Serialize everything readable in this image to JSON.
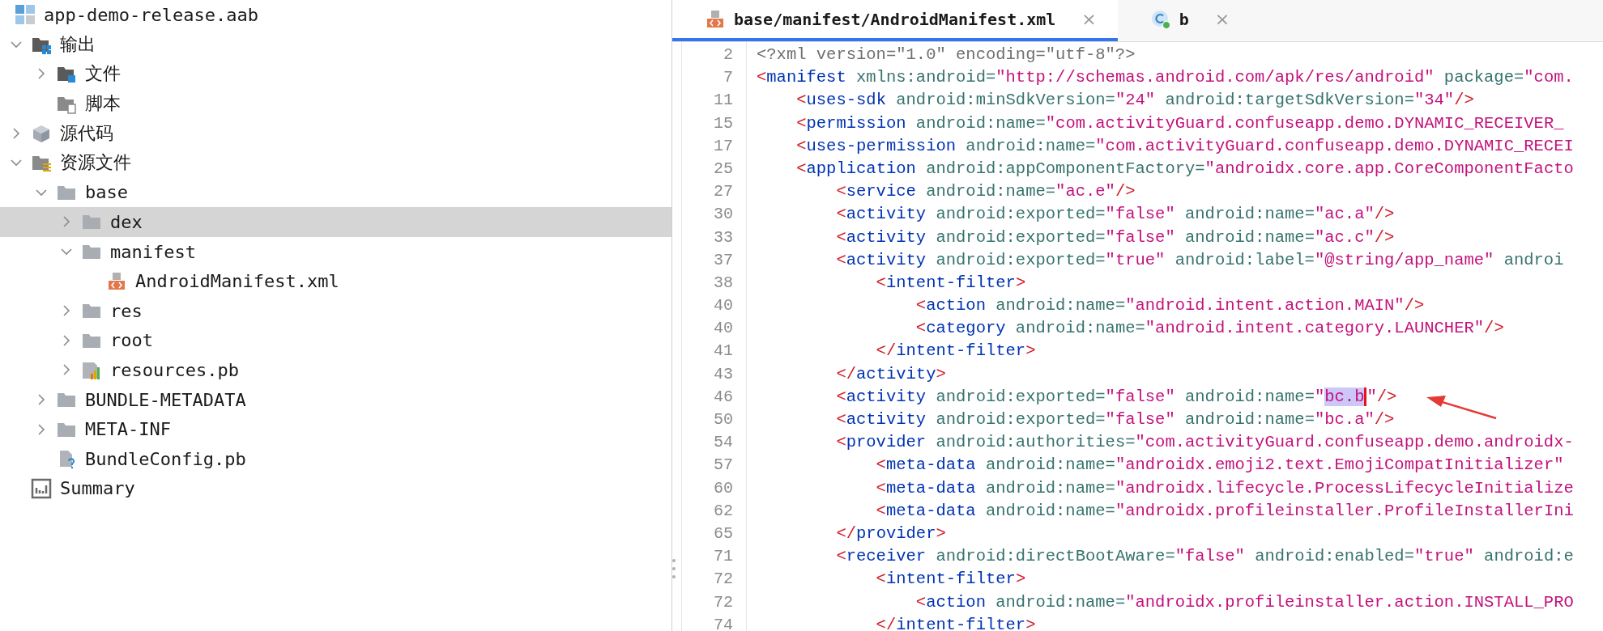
{
  "bundle": {
    "label": "app-demo-release.aab"
  },
  "tree": [
    {
      "label": "输出",
      "kind": "output-folder",
      "expanded": true,
      "selected": false,
      "children": [
        {
          "label": "文件",
          "kind": "files-folder",
          "expanded": false,
          "selected": false
        },
        {
          "label": "脚本",
          "kind": "scripts-folder",
          "selected": false
        }
      ]
    },
    {
      "label": "源代码",
      "kind": "source-package",
      "expanded": false,
      "selected": false
    },
    {
      "label": "资源文件",
      "kind": "resource-folder",
      "expanded": true,
      "selected": false,
      "children": [
        {
          "label": "base",
          "kind": "folder",
          "expanded": true,
          "selected": false,
          "children": [
            {
              "label": "dex",
              "kind": "folder",
              "expanded": false,
              "selected": true
            },
            {
              "label": "manifest",
              "kind": "folder",
              "expanded": true,
              "selected": false,
              "children": [
                {
                  "label": "AndroidManifest.xml",
                  "kind": "xml-file",
                  "selected": false
                }
              ]
            },
            {
              "label": "res",
              "kind": "folder",
              "expanded": false,
              "selected": false
            },
            {
              "label": "root",
              "kind": "folder",
              "expanded": false,
              "selected": false
            },
            {
              "label": "resources.pb",
              "kind": "resource-table",
              "expanded": false,
              "selected": false
            }
          ]
        },
        {
          "label": "BUNDLE-METADATA",
          "kind": "folder",
          "expanded": false,
          "selected": false
        },
        {
          "label": "META-INF",
          "kind": "folder",
          "expanded": false,
          "selected": false
        },
        {
          "label": "BundleConfig.pb",
          "kind": "config-file",
          "selected": false
        }
      ]
    },
    {
      "label": "Summary",
      "kind": "summary",
      "selected": false
    }
  ],
  "tabs": [
    {
      "label": "base/manifest/AndroidManifest.xml",
      "kind": "xml-file",
      "selected": true,
      "close": "×"
    },
    {
      "label": "b",
      "kind": "class-file",
      "selected": false,
      "close": "×"
    }
  ],
  "code_lines": [
    {
      "number": "2",
      "tokens": [
        {
          "kind": "pi",
          "text": "<?xml version=\"1.0\" encoding=\"utf-8\"?>"
        }
      ]
    },
    {
      "number": "7",
      "tokens": [
        {
          "kind": "bracket",
          "text": "<"
        },
        {
          "kind": "tag",
          "text": "manifest"
        },
        {
          "kind": "attr",
          "text": " xmlns:android="
        },
        {
          "kind": "value",
          "text": "\"http://schemas.android.com/apk/res/android\""
        },
        {
          "kind": "attr",
          "text": " package="
        },
        {
          "kind": "value",
          "text": "\"com."
        }
      ]
    },
    {
      "number": "11",
      "tokens": [
        {
          "kind": "bracket",
          "text": "    <"
        },
        {
          "kind": "tag",
          "text": "uses-sdk"
        },
        {
          "kind": "attr",
          "text": " android:minSdkVersion="
        },
        {
          "kind": "value",
          "text": "\"24\""
        },
        {
          "kind": "attr",
          "text": " android:targetSdkVersion="
        },
        {
          "kind": "value",
          "text": "\"34\""
        },
        {
          "kind": "bracket",
          "text": "/>"
        }
      ]
    },
    {
      "number": "15",
      "tokens": [
        {
          "kind": "bracket",
          "text": "    <"
        },
        {
          "kind": "tag",
          "text": "permission"
        },
        {
          "kind": "attr",
          "text": " android:name="
        },
        {
          "kind": "value",
          "text": "\"com.activityGuard.confuseapp.demo.DYNAMIC_RECEIVER_"
        }
      ]
    },
    {
      "number": "17",
      "tokens": [
        {
          "kind": "bracket",
          "text": "    <"
        },
        {
          "kind": "tag",
          "text": "uses-permission"
        },
        {
          "kind": "attr",
          "text": " android:name="
        },
        {
          "kind": "value",
          "text": "\"com.activityGuard.confuseapp.demo.DYNAMIC_RECEI"
        }
      ]
    },
    {
      "number": "25",
      "tokens": [
        {
          "kind": "bracket",
          "text": "    <"
        },
        {
          "kind": "tag",
          "text": "application"
        },
        {
          "kind": "attr",
          "text": " android:appComponentFactory="
        },
        {
          "kind": "value",
          "text": "\"androidx.core.app.CoreComponentFacto"
        }
      ]
    },
    {
      "number": "27",
      "tokens": [
        {
          "kind": "bracket",
          "text": "        <"
        },
        {
          "kind": "tag",
          "text": "service"
        },
        {
          "kind": "attr",
          "text": " android:name="
        },
        {
          "kind": "value",
          "text": "\"ac.e\""
        },
        {
          "kind": "bracket",
          "text": "/>"
        }
      ]
    },
    {
      "number": "30",
      "tokens": [
        {
          "kind": "bracket",
          "text": "        <"
        },
        {
          "kind": "tag",
          "text": "activity"
        },
        {
          "kind": "attr",
          "text": " android:exported="
        },
        {
          "kind": "value",
          "text": "\"false\""
        },
        {
          "kind": "attr",
          "text": " android:name="
        },
        {
          "kind": "value",
          "text": "\"ac.a\""
        },
        {
          "kind": "bracket",
          "text": "/>"
        }
      ]
    },
    {
      "number": "33",
      "tokens": [
        {
          "kind": "bracket",
          "text": "        <"
        },
        {
          "kind": "tag",
          "text": "activity"
        },
        {
          "kind": "attr",
          "text": " android:exported="
        },
        {
          "kind": "value",
          "text": "\"false\""
        },
        {
          "kind": "attr",
          "text": " android:name="
        },
        {
          "kind": "value",
          "text": "\"ac.c\""
        },
        {
          "kind": "bracket",
          "text": "/>"
        }
      ]
    },
    {
      "number": "37",
      "tokens": [
        {
          "kind": "bracket",
          "text": "        <"
        },
        {
          "kind": "tag",
          "text": "activity"
        },
        {
          "kind": "attr",
          "text": " android:exported="
        },
        {
          "kind": "value",
          "text": "\"true\""
        },
        {
          "kind": "attr",
          "text": " android:label="
        },
        {
          "kind": "value",
          "text": "\"@string/app_name\""
        },
        {
          "kind": "attr",
          "text": " androi"
        }
      ]
    },
    {
      "number": "38",
      "tokens": [
        {
          "kind": "bracket",
          "text": "            <"
        },
        {
          "kind": "tag",
          "text": "intent-filter"
        },
        {
          "kind": "bracket",
          "text": ">"
        }
      ]
    },
    {
      "number": "40",
      "tokens": [
        {
          "kind": "bracket",
          "text": "                <"
        },
        {
          "kind": "tag",
          "text": "action"
        },
        {
          "kind": "attr",
          "text": " android:name="
        },
        {
          "kind": "value",
          "text": "\"android.intent.action.MAIN\""
        },
        {
          "kind": "bracket",
          "text": "/>"
        }
      ]
    },
    {
      "number": "40",
      "tokens": [
        {
          "kind": "bracket",
          "text": "                <"
        },
        {
          "kind": "tag",
          "text": "category"
        },
        {
          "kind": "attr",
          "text": " android:name="
        },
        {
          "kind": "value",
          "text": "\"android.intent.category.LAUNCHER\""
        },
        {
          "kind": "bracket",
          "text": "/>"
        }
      ]
    },
    {
      "number": "41",
      "tokens": [
        {
          "kind": "bracket",
          "text": "            </"
        },
        {
          "kind": "tag",
          "text": "intent-filter"
        },
        {
          "kind": "bracket",
          "text": ">"
        }
      ]
    },
    {
      "number": "43",
      "tokens": [
        {
          "kind": "bracket",
          "text": "        </"
        },
        {
          "kind": "tag",
          "text": "activity"
        },
        {
          "kind": "bracket",
          "text": ">"
        }
      ]
    },
    {
      "number": "46",
      "tokens": [
        {
          "kind": "bracket",
          "text": "        <"
        },
        {
          "kind": "tag",
          "text": "activity"
        },
        {
          "kind": "attr",
          "text": " android:exported="
        },
        {
          "kind": "value",
          "text": "\"false\""
        },
        {
          "kind": "attr",
          "text": " android:name="
        },
        {
          "kind": "value",
          "text": "\""
        },
        {
          "kind": "selection",
          "text": "bc.b"
        },
        {
          "kind": "value",
          "text": "\""
        },
        {
          "kind": "bracket",
          "text": "/>"
        }
      ]
    },
    {
      "number": "50",
      "tokens": [
        {
          "kind": "bracket",
          "text": "        <"
        },
        {
          "kind": "tag",
          "text": "activity"
        },
        {
          "kind": "attr",
          "text": " android:exported="
        },
        {
          "kind": "value",
          "text": "\"false\""
        },
        {
          "kind": "attr",
          "text": " android:name="
        },
        {
          "kind": "value",
          "text": "\"bc.a\""
        },
        {
          "kind": "bracket",
          "text": "/>"
        }
      ]
    },
    {
      "number": "54",
      "tokens": [
        {
          "kind": "bracket",
          "text": "        <"
        },
        {
          "kind": "tag",
          "text": "provider"
        },
        {
          "kind": "attr",
          "text": " android:authorities="
        },
        {
          "kind": "value",
          "text": "\"com.activityGuard.confuseapp.demo.androidx-"
        }
      ]
    },
    {
      "number": "57",
      "tokens": [
        {
          "kind": "bracket",
          "text": "            <"
        },
        {
          "kind": "tag",
          "text": "meta-data"
        },
        {
          "kind": "attr",
          "text": " android:name="
        },
        {
          "kind": "value",
          "text": "\"androidx.emoji2.text.EmojiCompatInitializer\""
        }
      ]
    },
    {
      "number": "60",
      "tokens": [
        {
          "kind": "bracket",
          "text": "            <"
        },
        {
          "kind": "tag",
          "text": "meta-data"
        },
        {
          "kind": "attr",
          "text": " android:name="
        },
        {
          "kind": "value",
          "text": "\"androidx.lifecycle.ProcessLifecycleInitialize"
        }
      ]
    },
    {
      "number": "62",
      "tokens": [
        {
          "kind": "bracket",
          "text": "            <"
        },
        {
          "kind": "tag",
          "text": "meta-data"
        },
        {
          "kind": "attr",
          "text": " android:name="
        },
        {
          "kind": "value",
          "text": "\"androidx.profileinstaller.ProfileInstallerIni"
        }
      ]
    },
    {
      "number": "65",
      "tokens": [
        {
          "kind": "bracket",
          "text": "        </"
        },
        {
          "kind": "tag",
          "text": "provider"
        },
        {
          "kind": "bracket",
          "text": ">"
        }
      ]
    },
    {
      "number": "71",
      "tokens": [
        {
          "kind": "bracket",
          "text": "        <"
        },
        {
          "kind": "tag",
          "text": "receiver"
        },
        {
          "kind": "attr",
          "text": " android:directBootAware="
        },
        {
          "kind": "value",
          "text": "\"false\""
        },
        {
          "kind": "attr",
          "text": " android:enabled="
        },
        {
          "kind": "value",
          "text": "\"true\""
        },
        {
          "kind": "attr",
          "text": " android:e"
        }
      ]
    },
    {
      "number": "72",
      "tokens": [
        {
          "kind": "bracket",
          "text": "            <"
        },
        {
          "kind": "tag",
          "text": "intent-filter"
        },
        {
          "kind": "bracket",
          "text": ">"
        }
      ]
    },
    {
      "number": "72",
      "tokens": [
        {
          "kind": "bracket",
          "text": "                <"
        },
        {
          "kind": "tag",
          "text": "action"
        },
        {
          "kind": "attr",
          "text": " android:name="
        },
        {
          "kind": "value",
          "text": "\"androidx.profileinstaller.action.INSTALL_PRO"
        }
      ]
    },
    {
      "number": "74",
      "tokens": [
        {
          "kind": "bracket",
          "text": "            </"
        },
        {
          "kind": "tag",
          "text": "intent-filter"
        },
        {
          "kind": "bracket",
          "text": ">"
        }
      ]
    }
  ]
}
